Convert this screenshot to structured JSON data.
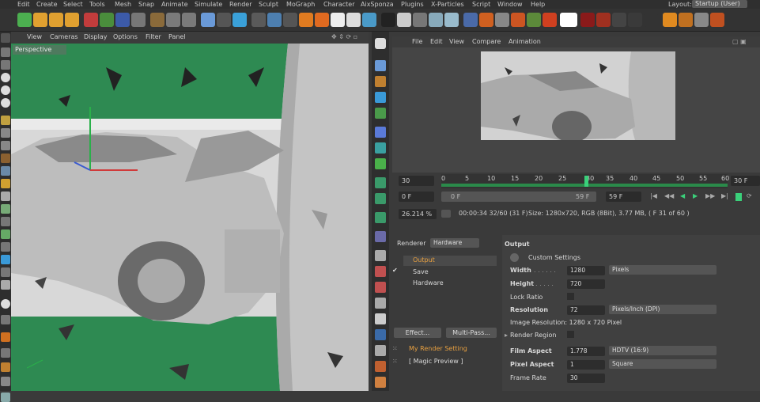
{
  "menubar": {
    "items": [
      "Edit",
      "Create",
      "Select",
      "Tools",
      "Mesh",
      "Snap",
      "Animate",
      "Simulate",
      "Render",
      "Sculpt",
      "MoGraph",
      "Character",
      "AixSponza",
      "Plugins",
      "X-Particles",
      "Script",
      "Window",
      "Help"
    ],
    "layout_label": "Layout:",
    "layout_value": "Startup (User)"
  },
  "viewport": {
    "menu": [
      "View",
      "Cameras",
      "Display",
      "Options",
      "Filter",
      "Panel"
    ],
    "label": "Perspective"
  },
  "picture_viewer": {
    "menu": [
      "File",
      "Edit",
      "View",
      "Compare",
      "Animation"
    ],
    "timeline": {
      "start_field": "30",
      "ticks": [
        "0",
        "5",
        "10",
        "15",
        "20",
        "25",
        "30",
        "35",
        "40",
        "45",
        "50",
        "55",
        "60"
      ],
      "end_field": "30 F",
      "current_frame_fraction": 0.5
    },
    "range": {
      "min_field": "0 F",
      "range_start": "0 F",
      "range_end": "59 F",
      "max_field": "59 F"
    },
    "info": {
      "zoom": "26.214 %",
      "time": "00:00:34 32/60 (31 F)",
      "size": "Size: 1280x720, RGB (8Bit), 3.77 MB, ( F 31 of 60 )"
    }
  },
  "render_settings": {
    "renderer_label": "Renderer",
    "renderer_value": "Hardware",
    "tree": [
      "Output",
      "Save",
      "Hardware"
    ],
    "effect_button": "Effect...",
    "multipass_button": "Multi-Pass...",
    "settings": [
      "My Render Setting",
      "[ Magic Preview ]"
    ],
    "output": {
      "title": "Output",
      "custom_settings": "Custom Settings",
      "width_label": "Width",
      "width_value": "1280",
      "width_unit": "Pixels",
      "height_label": "Height",
      "height_value": "720",
      "lock_ratio_label": "Lock Ratio",
      "resolution_label": "Resolution",
      "resolution_value": "72",
      "resolution_unit": "Pixels/Inch (DPI)",
      "image_resolution": "Image Resolution: 1280 x 720 Pixel",
      "render_region_label": "Render Region",
      "film_aspect_label": "Film Aspect",
      "film_aspect_value": "1.778",
      "film_aspect_preset": "HDTV (16:9)",
      "pixel_aspect_label": "Pixel Aspect",
      "pixel_aspect_value": "1",
      "pixel_aspect_preset": "Square",
      "frame_rate_label": "Frame Rate",
      "frame_rate_value": "30"
    }
  }
}
